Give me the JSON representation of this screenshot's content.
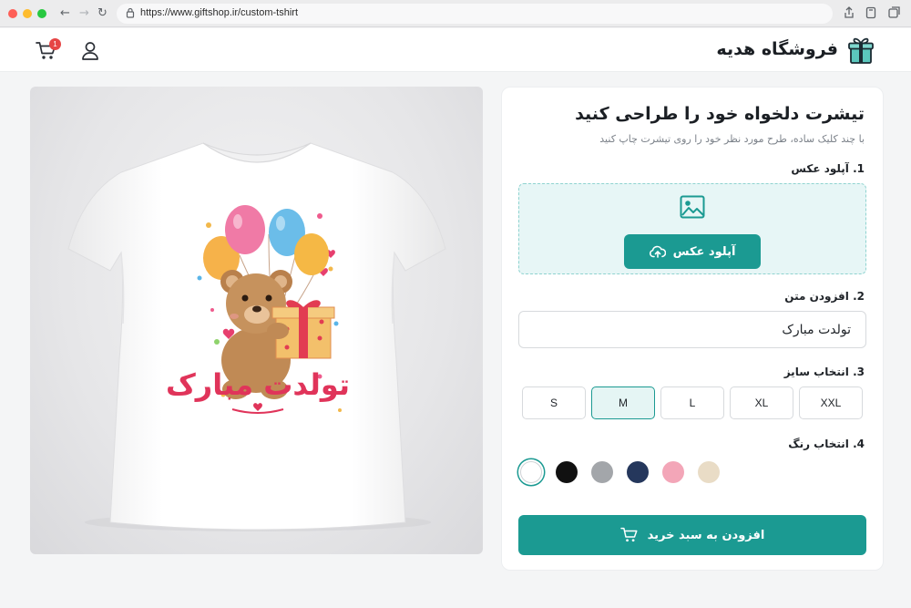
{
  "browser": {
    "url": "https://www.giftshop.ir/custom-tshirt"
  },
  "header": {
    "shop_name": "فروشگاه هدیه",
    "cart_count": "1"
  },
  "product": {
    "print_text": "تولدت مبارک"
  },
  "customizer": {
    "title": "تیشرت دلخواه خود را طراحی کنید",
    "subtitle": "با چند کلیک ساده، طرح مورد نظر خود را روی تیشرت چاپ کنید",
    "step1_label": "1. آپلود عکس",
    "upload_button": "آپلود عکس",
    "step2_label": "2. افزودن متن",
    "text_value": "تولدت مبارک",
    "step3_label": "3. انتخاب سایز",
    "sizes": [
      "S",
      "M",
      "L",
      "XL",
      "XXL"
    ],
    "selected_size": "M",
    "step4_label": "4. انتخاب رنگ",
    "colors": [
      "#ffffff",
      "#111111",
      "#a3a6aa",
      "#25375c",
      "#f3a6b8",
      "#e9dcc6"
    ],
    "selected_color": "#ffffff",
    "add_to_cart": "افزودن به سبد خرید"
  },
  "theme": {
    "accent": "#1b9a92",
    "accent_light": "#e7f6f6",
    "badge": "#e64545"
  }
}
